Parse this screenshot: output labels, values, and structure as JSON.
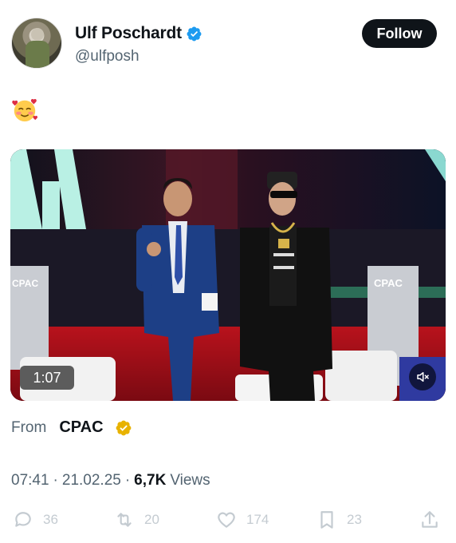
{
  "author": {
    "name": "Ulf Poschardt",
    "handle": "@ulfposh",
    "verified_color": "#1d9bf0",
    "avatar_icon": "avatar"
  },
  "follow_label": "Follow",
  "tweet_emoji": "smiling-face-with-hearts",
  "video": {
    "duration": "1:07",
    "muted": true,
    "stage_sign_left": "CPAC",
    "stage_sign_right": "CPAC"
  },
  "source": {
    "from_label": "From",
    "name": "CPAC",
    "badge_color": "#e8b200"
  },
  "meta": {
    "time": "07:41",
    "date": "21.02.25",
    "views_count": "6,7K",
    "views_label": "Views"
  },
  "actions": {
    "replies": "36",
    "reposts": "20",
    "likes": "174",
    "bookmarks": "23"
  }
}
